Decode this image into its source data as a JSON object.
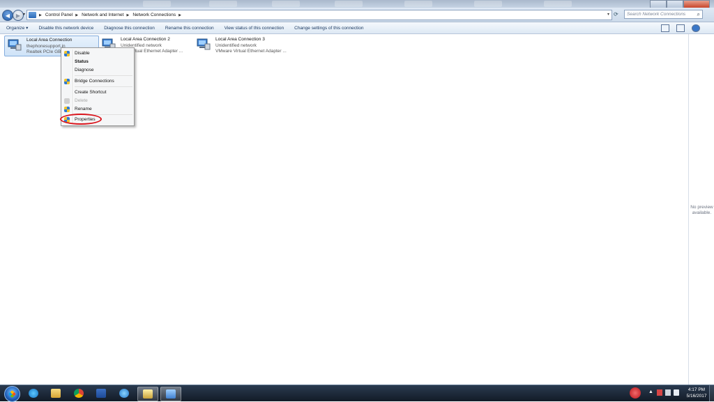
{
  "address_bar": {
    "breadcrumbs": [
      "Control Panel",
      "Network and Internet",
      "Network Connections"
    ]
  },
  "search": {
    "placeholder": "Search Network Connections"
  },
  "command_bar": {
    "organize": "Organize ▾",
    "disable": "Disable this network device",
    "diagnose": "Diagnose this connection",
    "rename": "Rename this connection",
    "view_status": "View status of this connection",
    "change_settings": "Change settings of this connection"
  },
  "connections": [
    {
      "name": "Local Area Connection",
      "network": "thephonesupport.in",
      "adapter": "Realtek PCIe GBE",
      "selected": true
    },
    {
      "name": "Local Area Connection 2",
      "network": "Unidentified network",
      "adapter": "...re Virtual Ethernet Adapter ..."
    },
    {
      "name": "Local Area Connection 3",
      "network": "Unidentified network",
      "adapter": "VMware Virtual Ethernet Adapter ..."
    }
  ],
  "context_menu": {
    "disable": "Disable",
    "status": "Status",
    "diagnose": "Diagnose",
    "bridge": "Bridge Connections",
    "shortcut": "Create Shortcut",
    "delete": "Delete",
    "rename": "Rename",
    "properties": "Properties"
  },
  "preview_pane": {
    "line1": "No preview",
    "line2": "available."
  },
  "taskbar": {
    "apps": [
      "internet-explorer",
      "file-explorer",
      "chrome",
      "word",
      "edge-like-browser",
      "folder",
      "network-connections"
    ],
    "time": "4:17 PM",
    "date": "5/16/2017"
  },
  "colors": {
    "accent": "#2f7bd1",
    "highlight_ring": "#d9141c"
  }
}
